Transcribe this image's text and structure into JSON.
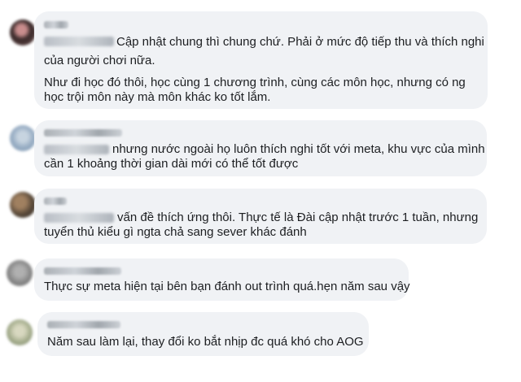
{
  "comments": [
    {
      "avatar_colors": [
        "#3a2a2a",
        "#c98d8d",
        "#6b4e4e"
      ],
      "lines": [
        "Cập nhật chung thì chung chứ. Phải ở mức độ tiếp thu và thích nghi",
        "của người chơi nữa.",
        "Như đi học đó thôi, học cùng 1 chương trình, cùng các môn học, nhưng có ng",
        "học trội môn này mà môn khác ko tốt lắm."
      ]
    },
    {
      "avatar_colors": [
        "#9fb3c8",
        "#6e8ba8",
        "#c7d4e0"
      ],
      "lines": [
        "nhưng nước ngoài họ luôn thích nghi tốt với meta, khu vực của mình",
        "cần 1 khoảng thời gian dài mới có thể tốt được"
      ]
    },
    {
      "avatar_colors": [
        "#5a4a3a",
        "#a08060",
        "#2f2a25"
      ],
      "lines": [
        "vấn đề thích ứng thôi. Thực tế là Đài cập nhật trước 1 tuần, nhưng",
        "tuyển thủ kiểu gì ngta chả sang sever khác đánh"
      ]
    },
    {
      "avatar_colors": [
        "#8a8a8a",
        "#5e5e5e",
        "#b0b0b0"
      ],
      "lines": [
        "Thực sự meta hiện tại bên bạn đánh out trình quá.hẹn năm sau vậy"
      ]
    },
    {
      "avatar_colors": [
        "#a8b090",
        "#d8d8c0",
        "#707a60"
      ],
      "lines": [
        "Năm sau làm lại, thay đổi ko bắt nhịp đc quá khó cho AOG"
      ]
    }
  ]
}
